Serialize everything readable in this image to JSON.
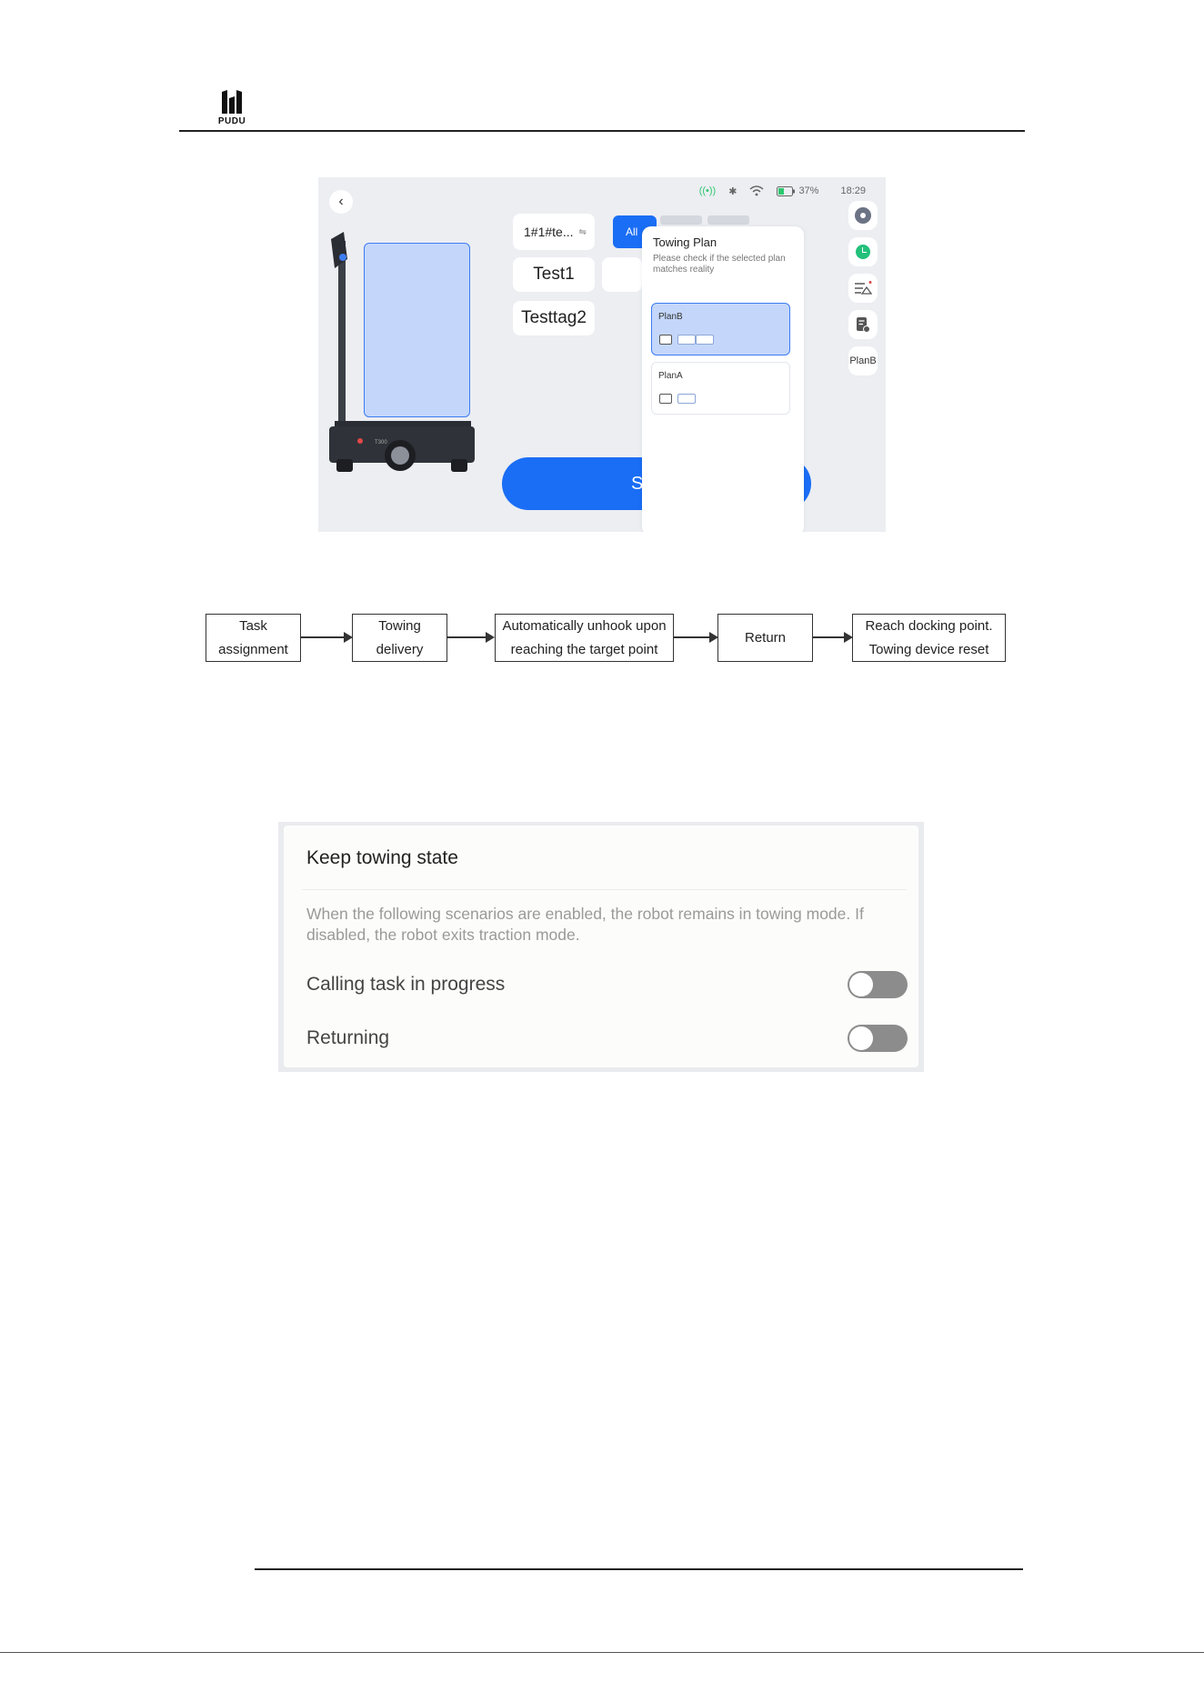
{
  "header": {
    "logo_text": "PUDU"
  },
  "app_screen": {
    "status": {
      "battery": "37%",
      "time": "18:29"
    },
    "tag_selector": "1#1#te...",
    "tabs": {
      "all": "All"
    },
    "tags": [
      "Test1",
      "Testtag2"
    ],
    "start_button": "S",
    "robot_badge": "T300",
    "towing_plan_popup": {
      "title": "Towing Plan",
      "subtitle": "Please check if the selected plan matches reality",
      "plans": [
        {
          "name": "PlanB",
          "selected": true
        },
        {
          "name": "PlanA",
          "selected": false
        }
      ]
    },
    "side_panel": {
      "plan_label": "PlanB"
    },
    "colors": {
      "accent": "#1a6ef5",
      "selected_bg": "#c4d7fb",
      "status_green": "#2ec76e"
    }
  },
  "flow": {
    "steps": [
      [
        "Task",
        "assignment"
      ],
      [
        "Towing",
        "delivery"
      ],
      [
        "Automatically unhook upon",
        "reaching the target point"
      ],
      [
        "Return"
      ],
      [
        "Reach docking point.",
        "Towing device reset"
      ]
    ]
  },
  "settings": {
    "title": "Keep towing state",
    "description": "When the following scenarios are enabled, the robot remains in towing mode. If disabled, the robot exits traction mode.",
    "options": [
      {
        "label": "Calling task in progress",
        "enabled": false
      },
      {
        "label": "Returning",
        "enabled": false
      }
    ]
  }
}
